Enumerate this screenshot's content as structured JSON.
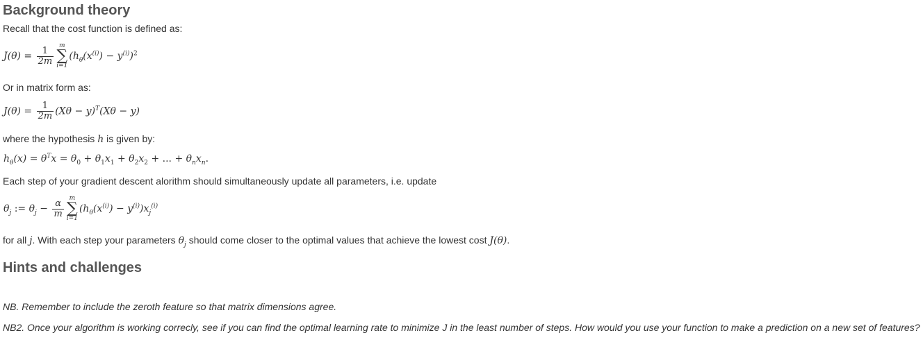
{
  "background_theory": {
    "heading": "Background theory",
    "intro": "Recall that the cost function is defined as:",
    "matrix_intro": "Or in matrix form as:",
    "hypothesis_intro_pre": "where the hypothesis",
    "hypothesis_symbol": "h",
    "hypothesis_intro_post": "is given by:",
    "gradient_intro": "Each step of your gradient descent alorithm should simultaneously update all parameters, i.e. update",
    "closing_pre": "for all",
    "closing_j": "j",
    "closing_mid": ". With each step your parameters",
    "closing_post": "should come closer to the optimal values that achieve the lowest cost",
    "closing_end": "."
  },
  "hints": {
    "heading": "Hints and challenges",
    "nb1": "NB. Remember to include the zeroth feature so that matrix dimensions agree.",
    "nb2": "NB2. Once your algorithm is working correcly, see if you can find the optimal learning rate to minimize J in the least number of steps. How would you use your function to make a prediction on a new set of features?"
  }
}
